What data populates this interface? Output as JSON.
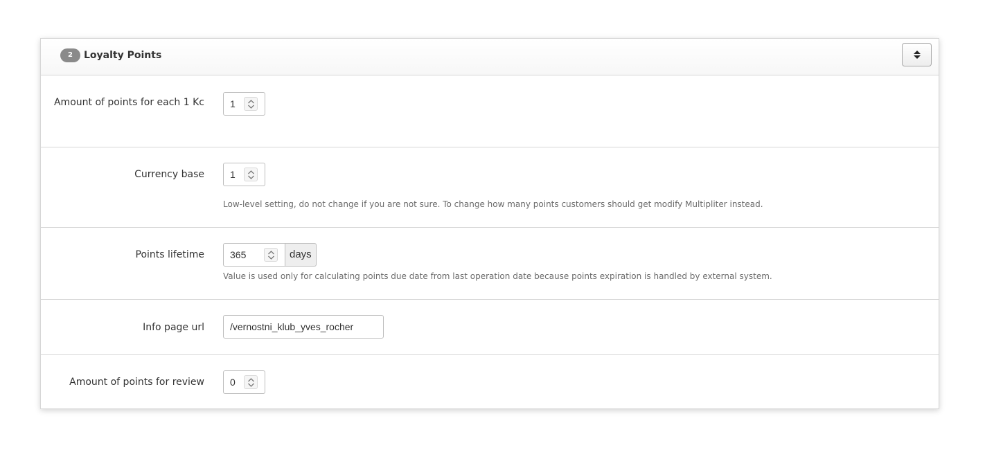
{
  "panel": {
    "badge": "2",
    "title": "Loyalty Points"
  },
  "fields": {
    "points_per_unit": {
      "label": "Amount of points for each 1 Kc",
      "value": "1"
    },
    "currency_base": {
      "label": "Currency base",
      "value": "1",
      "help": "Low-level setting, do not change if you are not sure. To change how many points customers should get modify Multipliter instead."
    },
    "points_lifetime": {
      "label": "Points lifetime",
      "value": "365",
      "addon": "days",
      "help": "Value is used only for calculating points due date from last operation date because points expiration is handled by external system."
    },
    "info_page_url": {
      "label": "Info page url",
      "value": "/vernostni_klub_yves_rocher"
    },
    "points_for_review": {
      "label": "Amount of points for review",
      "value": "0"
    }
  },
  "icons": {
    "toggle": "sort-icon",
    "stepper": "chevron-up-down-icon"
  }
}
